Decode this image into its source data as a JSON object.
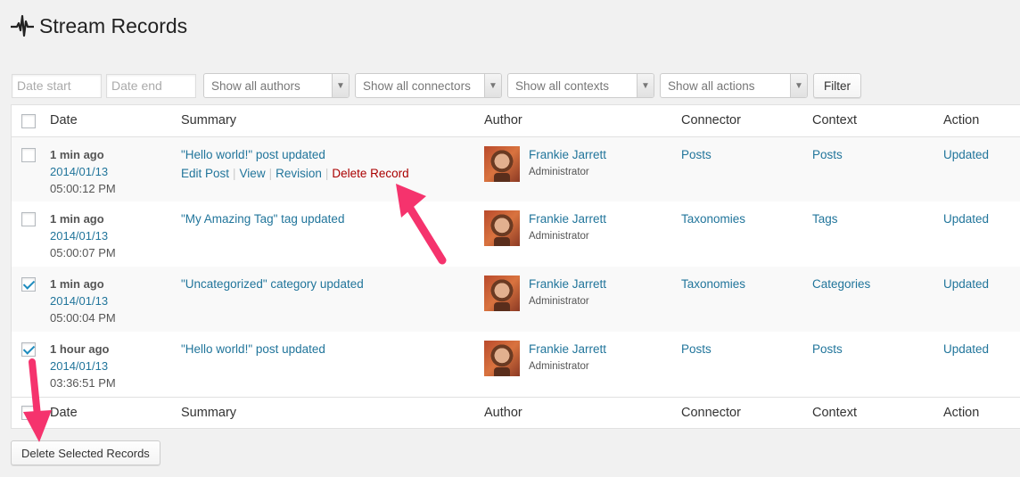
{
  "page": {
    "title": "Stream Records"
  },
  "filters": {
    "date_start_placeholder": "Date start",
    "date_end_placeholder": "Date end",
    "authors": "Show all authors",
    "connectors": "Show all connectors",
    "contexts": "Show all contexts",
    "actions": "Show all actions",
    "filter_button": "Filter"
  },
  "table": {
    "columns": {
      "date": "Date",
      "summary": "Summary",
      "author": "Author",
      "connector": "Connector",
      "context": "Context",
      "action": "Action"
    },
    "rows": [
      {
        "checked": false,
        "relative": "1 min ago",
        "date": "2014/01/13",
        "time": "05:00:12 PM",
        "summary": "\"Hello world!\" post updated",
        "row_actions": [
          "Edit Post",
          "View",
          "Revision",
          "Delete Record"
        ],
        "author": "Frankie Jarrett",
        "role": "Administrator",
        "connector": "Posts",
        "context": "Posts",
        "action": "Updated"
      },
      {
        "checked": false,
        "relative": "1 min ago",
        "date": "2014/01/13",
        "time": "05:00:07 PM",
        "summary": "\"My Amazing Tag\" tag updated",
        "author": "Frankie Jarrett",
        "role": "Administrator",
        "connector": "Taxonomies",
        "context": "Tags",
        "action": "Updated"
      },
      {
        "checked": true,
        "relative": "1 min ago",
        "date": "2014/01/13",
        "time": "05:00:04 PM",
        "summary": "\"Uncategorized\" category updated",
        "author": "Frankie Jarrett",
        "role": "Administrator",
        "connector": "Taxonomies",
        "context": "Categories",
        "action": "Updated"
      },
      {
        "checked": true,
        "relative": "1 hour ago",
        "date": "2014/01/13",
        "time": "03:36:51 PM",
        "summary": "\"Hello world!\" post updated",
        "author": "Frankie Jarrett",
        "role": "Administrator",
        "connector": "Posts",
        "context": "Posts",
        "action": "Updated"
      }
    ]
  },
  "bulk": {
    "delete_selected": "Delete Selected Records"
  },
  "colors": {
    "link": "#21759b",
    "delete": "#aa0000",
    "annotation": "#f5336d"
  }
}
